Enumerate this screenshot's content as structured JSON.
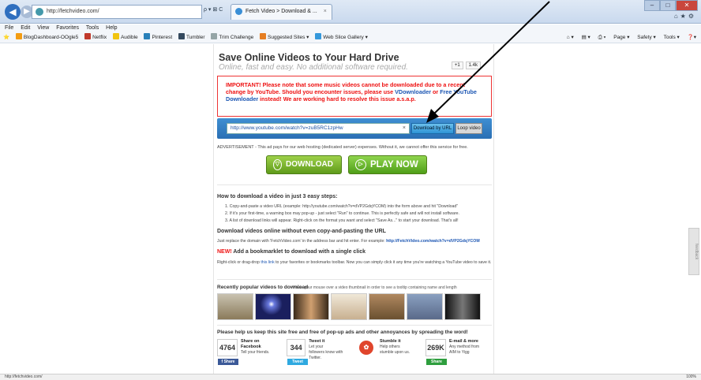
{
  "browser": {
    "address": "http://fetchvideo.com/",
    "address_tools": "ρ ▾ ⊠ C",
    "tab_label": "Fetch Video > Download & ...",
    "menus": [
      "File",
      "Edit",
      "View",
      "Favorites",
      "Tools",
      "Help"
    ],
    "favorites": [
      {
        "label": "BlogDashboard-OOgle5",
        "color": "#f39c12"
      },
      {
        "label": "Netflix",
        "color": "#c0392b"
      },
      {
        "label": "Audible",
        "color": "#f1c40f"
      },
      {
        "label": "Pinterest",
        "color": "#2980b9"
      },
      {
        "label": "Tumbler",
        "color": "#34495e"
      },
      {
        "label": "Trim Challenge",
        "color": "#95a5a6"
      },
      {
        "label": "Suggested Sites ▾",
        "color": "#e67e22"
      },
      {
        "label": "Web Slice Gallery ▾",
        "color": "#3498db"
      }
    ],
    "commands": [
      "Page ▾",
      "Safety ▾",
      "Tools ▾"
    ],
    "status_url": "http://fetchvideo.com/",
    "zoom": "100%"
  },
  "page": {
    "title": "Save Online Videos to Your Hard Drive",
    "subtitle": "Online, fast and easy. No additional software required.",
    "like_count": "1.4k",
    "alert_text_1": "IMPORTANT! Please note that some music videos cannot be downloaded due to a recent change by YouTube. Should you encounter issues, please use ",
    "alert_link_1": "VDownloader",
    "alert_text_2": " or ",
    "alert_link_2": "Free YouTube Downloader",
    "alert_text_3": " instead! We are working hard to resolve this issue a.s.a.p.",
    "url_value": "http://www.youtube.com/watch?v=zuB5RC1zpHw",
    "download_by_url": "Download by URL",
    "loop_video": "Loop video",
    "ad_text": "ADVERTISEMENT - This ad pays for our web hosting (dedicated server) expenses. Without it, we cannot offer this service for free.",
    "download_btn": "DOWNLOAD",
    "play_now_btn": "PLAY NOW",
    "howto_heading": "How to download a video in just 3 easy steps:",
    "steps": [
      "1.  Copy-and-paste a video URL (example: http://youtube.com/watch?v=dVP2GdqYCOM) into the form above and hit \"Download\"",
      "2.  If it's your first-time, a warning box may pop-up - just select \"Run\" to continue. This is perfectly safe and will not install software.",
      "3.  A list of download links will appear. Right-click on the format you want and select \"Save As...\" to start your download. That's all!"
    ],
    "no_copy_heading": "Download videos online without even copy-and-pasting the URL",
    "no_copy_text": "Just replace the domain with 'FetchVideo.com' in the address bar and hit enter. For example: ",
    "no_copy_example": "http://FetchVideo.com/watch?v=dVP2GdqYCOM",
    "bookmarklet_new": "NEW!",
    "bookmarklet_heading": " Add a bookmarklet to download with a single click",
    "bookmarklet_text_1": "Right-click or drag-drop ",
    "bookmarklet_link": "this link",
    "bookmarklet_text_2": " to your favorites or bookmarks toolbar. Now you can simply click it any time you're watching a YouTube video to save it.",
    "popular_heading": "Recently popular videos to download",
    "popular_note": "Hover your mouse over a video thumbnail in order to see a tooltip containing name and length",
    "thumb_colors": [
      "#8a7a5a",
      "#1a1f5e",
      "#3a2a1a",
      "#c8b090",
      "#6a5030",
      "#5a6a8a",
      "#2a2a2a"
    ],
    "share_heading": "Please help us keep this site free and free of pop-up ads and other annoyances by spreading the word!",
    "shares": [
      {
        "count": "4764",
        "btn": "f Share",
        "btn_color": "#3b5998",
        "t1": "Share on",
        "t2": "Facebook",
        "t3": "Tell your friends."
      },
      {
        "count": "344",
        "btn": "Tweet",
        "btn_color": "#2fa9e0",
        "t1": "Tweet it",
        "t2": "Let your",
        "t3": "followers know with Twitter."
      },
      {
        "count": "",
        "btn": "",
        "btn_color": "#e0452c",
        "t1": "Stumble it",
        "t2": "Help others",
        "t3": "stumble upon us."
      },
      {
        "count": "269K",
        "btn": "Share",
        "btn_color": "#2e9e3e",
        "t1": "E-mail & more",
        "t2": "Any method from",
        "t3": "AIM to Yigg"
      }
    ],
    "feedback": "feedback"
  }
}
